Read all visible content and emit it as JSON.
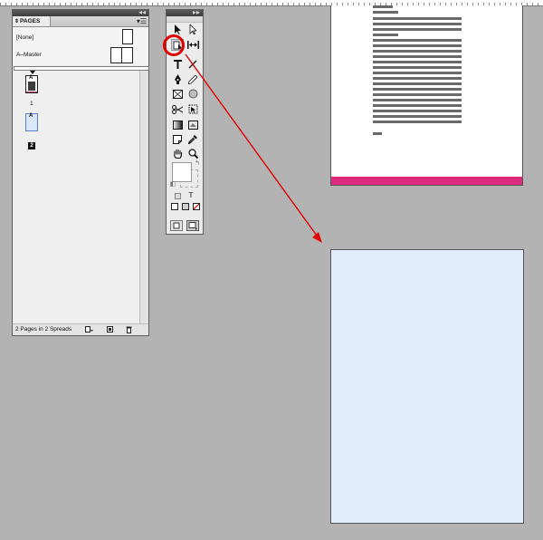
{
  "pages_panel": {
    "tab_label": "PAGES",
    "tab_arrow": "⇕",
    "collapse_glyph": "◂◂",
    "menu_glyph": "▾☰",
    "masters": [
      {
        "label": "[None]"
      },
      {
        "label": "A–Master"
      }
    ],
    "pages": [
      {
        "prefix": "A",
        "number": "1"
      },
      {
        "prefix": "A",
        "number": "2"
      }
    ],
    "status_text": "2 Pages in 2 Spreads",
    "status_icons": [
      "page-size-icon",
      "new-page-icon",
      "delete-page-icon"
    ]
  },
  "tools_panel": {
    "collapse_glyph": "▸▸",
    "type_tool_label": "T",
    "tools": [
      "selection-tool-icon",
      "direct-selection-tool-icon",
      "page-tool-icon",
      "gap-tool-icon",
      "type-tool-icon",
      "line-tool-icon",
      "pen-tool-icon",
      "pencil-tool-icon",
      "rectangle-frame-tool-icon",
      "ellipse-tool-icon",
      "scissors-tool-icon",
      "free-transform-tool-icon",
      "gradient-swatch-tool-icon",
      "gradient-feather-tool-icon",
      "note-tool-icon",
      "eyedropper-tool-icon",
      "hand-tool-icon",
      "zoom-tool-icon"
    ]
  },
  "colors": {
    "page1_footer": "#dc2a7c",
    "page2_fill": "#e3eefc",
    "annotation": "#e00000",
    "pasteboard": "#b3b3b3"
  }
}
